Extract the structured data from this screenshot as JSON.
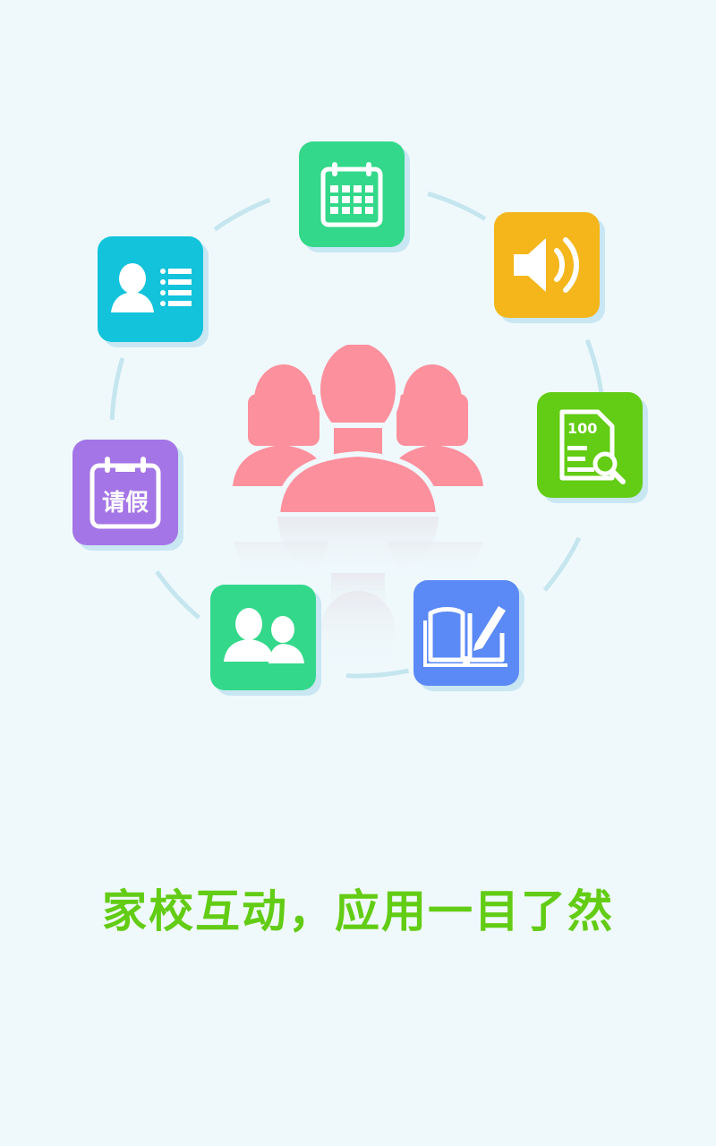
{
  "tagline": "家校互动，应用一目了然",
  "colors": {
    "background": "#eff9fc",
    "ring": "#c5e6ee",
    "tagline": "#63cc14",
    "people": "#fd909d"
  },
  "apps": [
    {
      "id": "calendar",
      "icon": "calendar-icon",
      "color": "#33d88a"
    },
    {
      "id": "audio",
      "icon": "speaker-icon",
      "color": "#f4b61b"
    },
    {
      "id": "score",
      "icon": "score-report-icon",
      "color": "#63cc14"
    },
    {
      "id": "homework",
      "icon": "book-pencil-icon",
      "color": "#5b8af7"
    },
    {
      "id": "contacts",
      "icon": "two-people-icon",
      "color": "#33d88a"
    },
    {
      "id": "leave",
      "icon": "leave-calendar-icon",
      "color": "#a475e6",
      "label": "请假"
    },
    {
      "id": "profile",
      "icon": "contact-card-icon",
      "color": "#12c3db"
    }
  ]
}
